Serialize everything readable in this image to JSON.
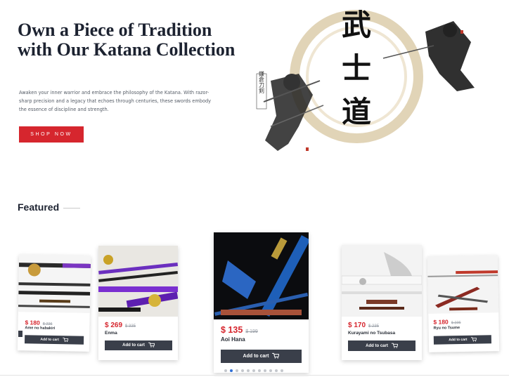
{
  "hero": {
    "title": "Own a Piece of Tradition with Our Katana Collection",
    "subtitle": "Awaken your inner warrior and embrace the philosophy of the Katana. With razor-sharp precision and a legacy that echoes through centuries, these swords embody the essence of discipline and strength.",
    "cta_label": "SHOP NOW",
    "art_main_text": "武士道",
    "art_side_text": "鎌倉刀剣"
  },
  "featured": {
    "title": "Featured",
    "cart_label": "Add to cart",
    "cart_icon": "cart-icon",
    "products": [
      {
        "price": "$ 180",
        "old_price": "$ 236",
        "name": "Ame no habakiri"
      },
      {
        "price": "$ 269",
        "old_price": "$ 335",
        "name": "Enma"
      },
      {
        "price": "$ 135",
        "old_price": "$ 199",
        "name": "Aoi Hana"
      },
      {
        "price": "$ 170",
        "old_price": "$ 235",
        "name": "Kurayami no Tsubasa"
      },
      {
        "price": "$ 180",
        "old_price": "$ 235",
        "name": "Ryu no Tsume"
      }
    ],
    "carousel": {
      "total_dots": 11,
      "active_index": 1
    }
  },
  "colors": {
    "accent": "#d6262e",
    "button_dark": "#3a3f4a",
    "title": "#1c2230",
    "dot_active": "#2f6fd6"
  }
}
